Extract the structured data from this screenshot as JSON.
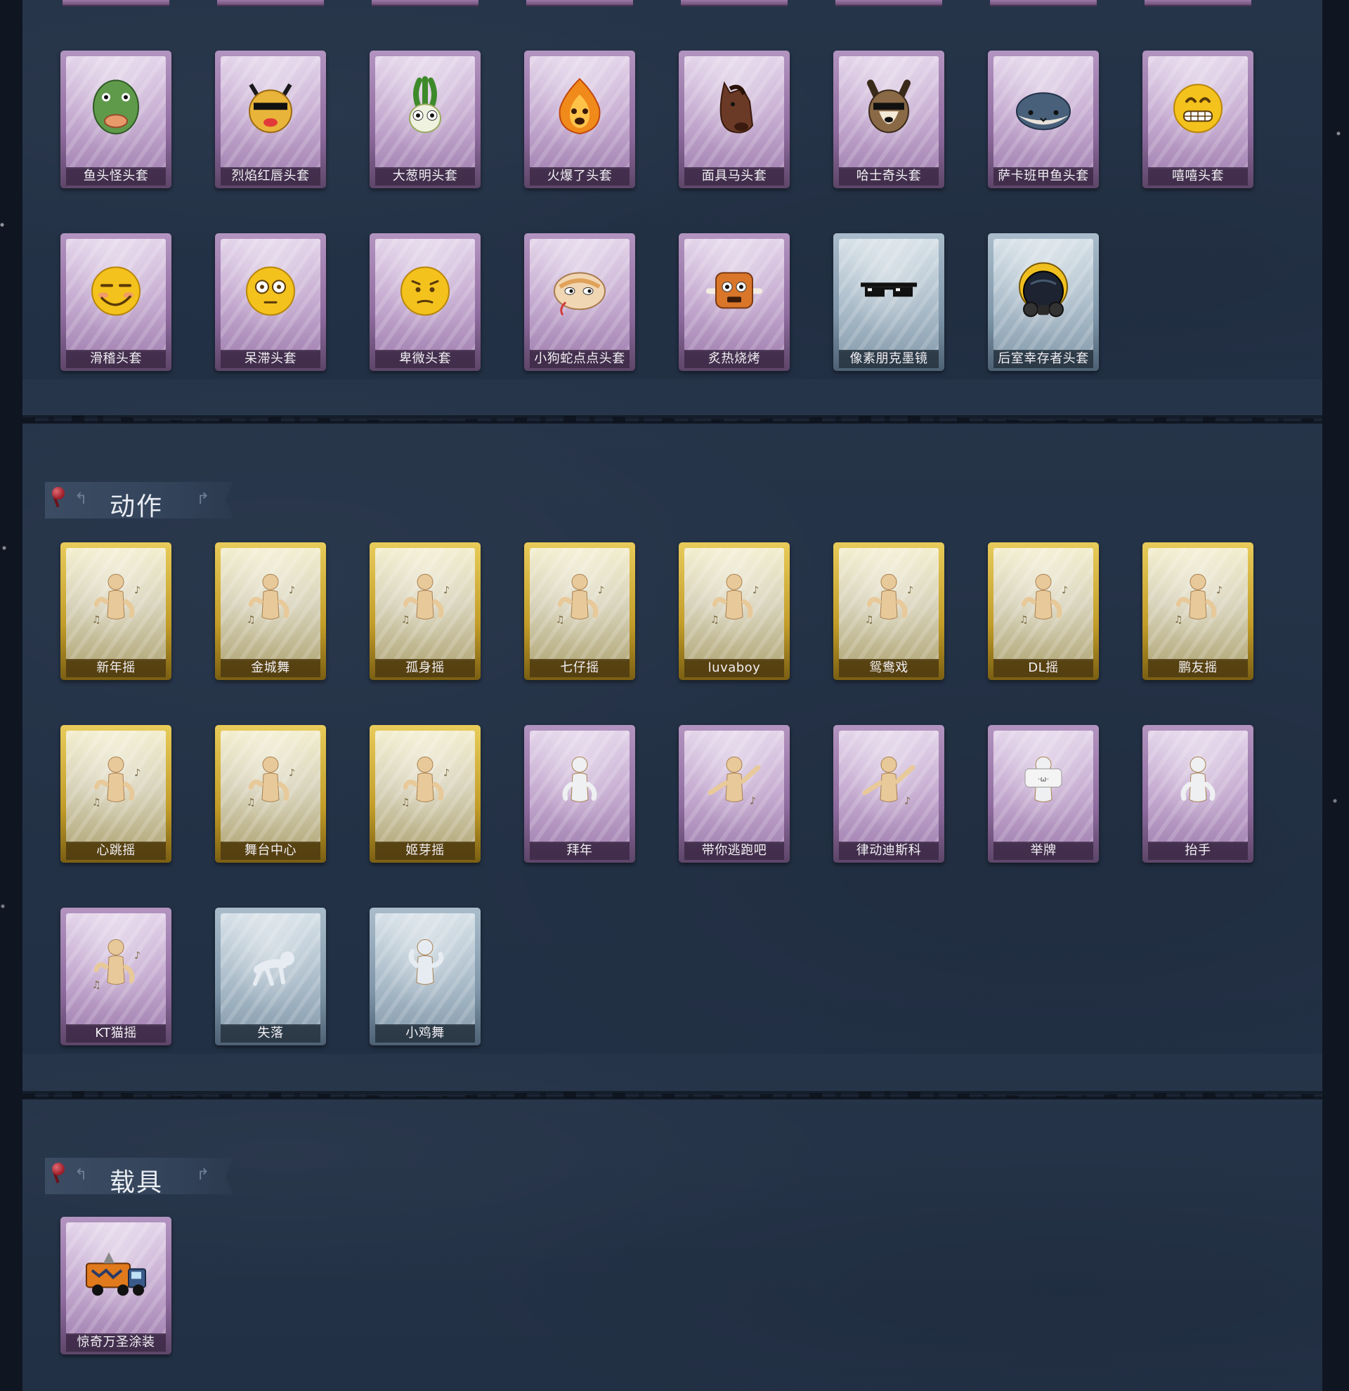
{
  "sections": [
    {
      "id": "headgear",
      "title": "",
      "rows": [
        [
          {
            "label": "鱼头怪头套",
            "rarity": "purple",
            "icon": "fish-head-mask-icon",
            "color": "#5f9a4a"
          },
          {
            "label": "烈焰红唇头套",
            "rarity": "purple",
            "icon": "yellow-creature-sunglasses-icon",
            "color": "#e9b43a"
          },
          {
            "label": "大葱明头套",
            "rarity": "purple",
            "icon": "green-onion-head-icon",
            "color": "#8ccb4a"
          },
          {
            "label": "火爆了头套",
            "rarity": "purple",
            "icon": "fire-head-icon",
            "color": "#f08a1a"
          },
          {
            "label": "面具马头套",
            "rarity": "purple",
            "icon": "horse-mask-icon",
            "color": "#6b3a26"
          },
          {
            "label": "哈士奇头套",
            "rarity": "purple",
            "icon": "husky-sunglasses-icon",
            "color": "#8a6a46"
          },
          {
            "label": "萨卡班甲鱼头套",
            "rarity": "purple",
            "icon": "fish-blob-icon",
            "color": "#48607a"
          },
          {
            "label": "嘻嘻头套",
            "rarity": "purple",
            "icon": "grinning-emoji-icon",
            "color": "#f4c21c"
          }
        ],
        [
          {
            "label": "滑稽头套",
            "rarity": "purple",
            "icon": "smirk-emoji-icon",
            "color": "#f4c21c"
          },
          {
            "label": "呆滞头套",
            "rarity": "purple",
            "icon": "dazed-emoji-icon",
            "color": "#f4c21c"
          },
          {
            "label": "卑微头套",
            "rarity": "purple",
            "icon": "humble-emoji-icon",
            "color": "#f4c21c"
          },
          {
            "label": "小狗蛇点点头套",
            "rarity": "purple",
            "icon": "snake-head-icon",
            "color": "#f1d6b3"
          },
          {
            "label": "炙热烧烤",
            "rarity": "purple",
            "icon": "bbq-block-icon",
            "color": "#d9762a"
          },
          {
            "label": "像素朋克墨镜",
            "rarity": "blue",
            "icon": "pixel-sunglasses-icon",
            "color": "#111111"
          },
          {
            "label": "后室幸存者头套",
            "rarity": "blue",
            "icon": "gas-mask-helmet-icon",
            "color": "#1d2330"
          }
        ]
      ]
    },
    {
      "id": "actions",
      "title": "动作",
      "rows": [
        [
          {
            "label": "新年摇",
            "rarity": "gold",
            "icon": "dance-figure-icon"
          },
          {
            "label": "金城舞",
            "rarity": "gold",
            "icon": "dance-figure-icon"
          },
          {
            "label": "孤身摇",
            "rarity": "gold",
            "icon": "dance-figure-icon"
          },
          {
            "label": "七仔摇",
            "rarity": "gold",
            "icon": "dance-figure-icon"
          },
          {
            "label": "luvaboy",
            "rarity": "gold",
            "icon": "dance-figure-icon"
          },
          {
            "label": "鸳鸯戏",
            "rarity": "gold",
            "icon": "dance-figure-icon"
          },
          {
            "label": "DL摇",
            "rarity": "gold",
            "icon": "dance-figure-icon"
          },
          {
            "label": "鹏友摇",
            "rarity": "gold",
            "icon": "dance-figure-icon"
          }
        ],
        [
          {
            "label": "心跳摇",
            "rarity": "gold",
            "icon": "dance-figure-icon"
          },
          {
            "label": "舞台中心",
            "rarity": "gold",
            "icon": "dance-figure-icon"
          },
          {
            "label": "姬芽摇",
            "rarity": "gold",
            "icon": "dance-figure-icon"
          },
          {
            "label": "拜年",
            "rarity": "purple",
            "icon": "bow-figure-icon"
          },
          {
            "label": "带你逃跑吧",
            "rarity": "purple",
            "icon": "run-figure-icon"
          },
          {
            "label": "律动迪斯科",
            "rarity": "purple",
            "icon": "disco-figure-icon"
          },
          {
            "label": "举牌",
            "rarity": "purple",
            "icon": "sign-figure-icon"
          },
          {
            "label": "抬手",
            "rarity": "purple",
            "icon": "raise-hand-figure-icon"
          }
        ],
        [
          {
            "label": "KT猫摇",
            "rarity": "purple",
            "icon": "dance-figure-icon"
          },
          {
            "label": "失落",
            "rarity": "blue",
            "icon": "crawl-figure-icon"
          },
          {
            "label": "小鸡舞",
            "rarity": "blue",
            "icon": "chicken-dance-figure-icon"
          }
        ]
      ]
    },
    {
      "id": "vehicles",
      "title": "载具",
      "rows": [
        [
          {
            "label": "惊奇万圣涂装",
            "rarity": "purple",
            "icon": "halloween-truck-icon",
            "color": "#e07a1c"
          }
        ]
      ]
    }
  ],
  "colors": {
    "rarity_purple": "#8e6b9e",
    "rarity_gold": "#c29c28",
    "rarity_blue": "#7f96a9",
    "panel_bg": "#243247"
  }
}
